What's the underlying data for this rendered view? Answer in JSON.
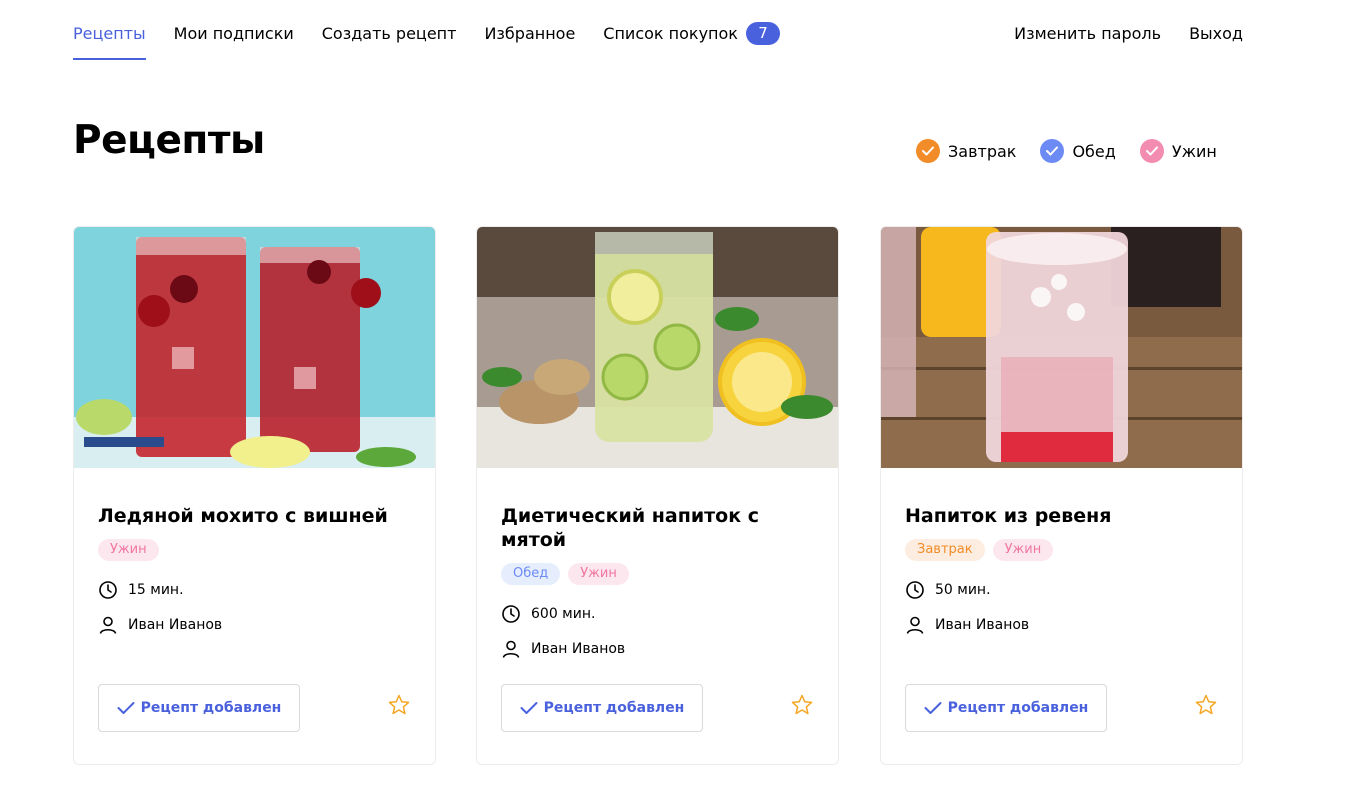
{
  "nav": {
    "items": [
      {
        "label": "Рецепты",
        "active": true
      },
      {
        "label": "Мои подписки"
      },
      {
        "label": "Создать рецепт"
      },
      {
        "label": "Избранное"
      },
      {
        "label": "Список покупок"
      }
    ],
    "cart_count": "7",
    "change_password": "Изменить пароль",
    "logout": "Выход"
  },
  "page": {
    "title": "Рецепты"
  },
  "filters": [
    {
      "label": "Завтрак",
      "color": "#F28C28"
    },
    {
      "label": "Обед",
      "color": "#6C8BF5"
    },
    {
      "label": "Ужин",
      "color": "#F28CB1"
    }
  ],
  "tag_styles": {
    "Завтрак": {
      "bg": "#FDEDE0",
      "fg": "#F28C28"
    },
    "Обед": {
      "bg": "#E6EDFD",
      "fg": "#6C8BF5"
    },
    "Ужин": {
      "bg": "#FDE7EF",
      "fg": "#F076A1"
    }
  },
  "recipes": [
    {
      "title": "Ледяной мохито с вишней",
      "tags": [
        "Ужин"
      ],
      "time": "15 мин.",
      "author": "Иван Иванов",
      "button": "Рецепт добавлен",
      "image": "cherry-mojito-photo"
    },
    {
      "title": "Диетический напиток с мятой",
      "tags": [
        "Обед",
        "Ужин"
      ],
      "time": "600 мин.",
      "author": "Иван Иванов",
      "button": "Рецепт добавлен",
      "image": "mint-drink-photo"
    },
    {
      "title": "Напиток из ревеня",
      "tags": [
        "Завтрак",
        "Ужин"
      ],
      "time": "50 мин.",
      "author": "Иван Иванов",
      "button": "Рецепт добавлен",
      "image": "rhubarb-drink-photo"
    }
  ],
  "colors": {
    "accent": "#4A61DD",
    "star": "#F5A623"
  }
}
